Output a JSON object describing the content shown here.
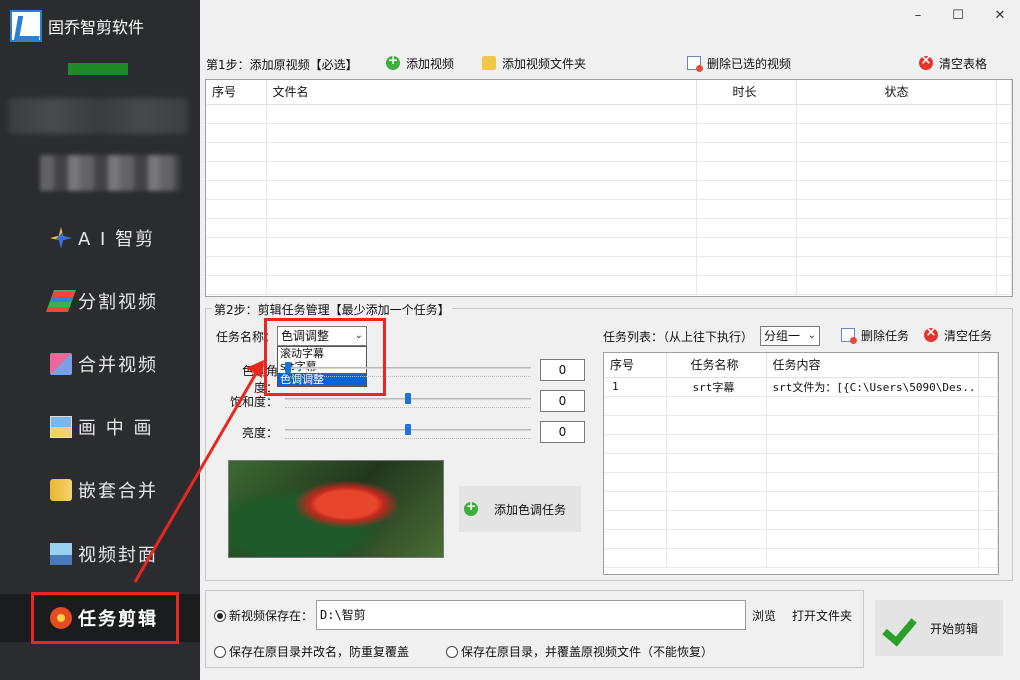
{
  "app": {
    "title": "固乔智剪软件"
  },
  "window": {
    "minimize": "–",
    "maximize": "☐",
    "close": "✕"
  },
  "sidebar": {
    "items": [
      {
        "label": "A I 智剪",
        "icon": "ai-icon"
      },
      {
        "label": "分割视频",
        "icon": "split-icon"
      },
      {
        "label": "合并视频",
        "icon": "merge-icon"
      },
      {
        "label": "画 中 画",
        "icon": "pip-icon"
      },
      {
        "label": "嵌套合并",
        "icon": "nest-icon"
      },
      {
        "label": "视频封面",
        "icon": "cover-icon"
      },
      {
        "label": "任务剪辑",
        "icon": "task-icon",
        "active": true
      }
    ]
  },
  "step1": {
    "label": "第1步：添加原视频【必选】",
    "add_video": "添加视频",
    "add_folder": "添加视频文件夹",
    "delete_selected": "删除已选的视频",
    "clear_table": "清空表格",
    "columns": [
      "序号",
      "文件名",
      "时长",
      "状态"
    ]
  },
  "step2": {
    "label": "第2步：剪辑任务管理【最少添加一个任务】",
    "task_name_label": "任务名称：",
    "task_select_value": "色调调整",
    "task_options": [
      "滚动字幕",
      "srt字幕",
      "色调调整"
    ],
    "hue_label": "色调角度：",
    "saturation_label": "饱和度：",
    "brightness_label": "亮度：",
    "hue_value": "0",
    "saturation_value": "0",
    "brightness_value": "0",
    "hue_level": 0.0,
    "saturation_level": 0.5,
    "brightness_level": 0.5,
    "add_task_button": "添加色调任务",
    "task_list_label": "任务列表：（从上往下执行）",
    "group_select": "分组一",
    "delete_task": "删除任务",
    "clear_tasks": "清空任务",
    "task_columns": [
      "序号",
      "任务名称",
      "任务内容"
    ],
    "task_rows": [
      {
        "index": "1",
        "name": "srt字幕",
        "content": "srt文件为：[{C:\\Users\\5090\\Des..."
      }
    ]
  },
  "output": {
    "save_new_label": "新视频保存在：",
    "save_path": "D:\\智剪",
    "browse": "浏览",
    "open_folder": "打开文件夹",
    "save_rename_label": "保存在原目录并改名，防重复覆盖",
    "save_overwrite_label": "保存在原目录，并覆盖原视频文件（不能恢复）",
    "start_button": "开始剪辑"
  },
  "colors": {
    "accent": "#1a73d8",
    "annotation": "#e8281e",
    "sidebar": "#2b2c2f"
  }
}
